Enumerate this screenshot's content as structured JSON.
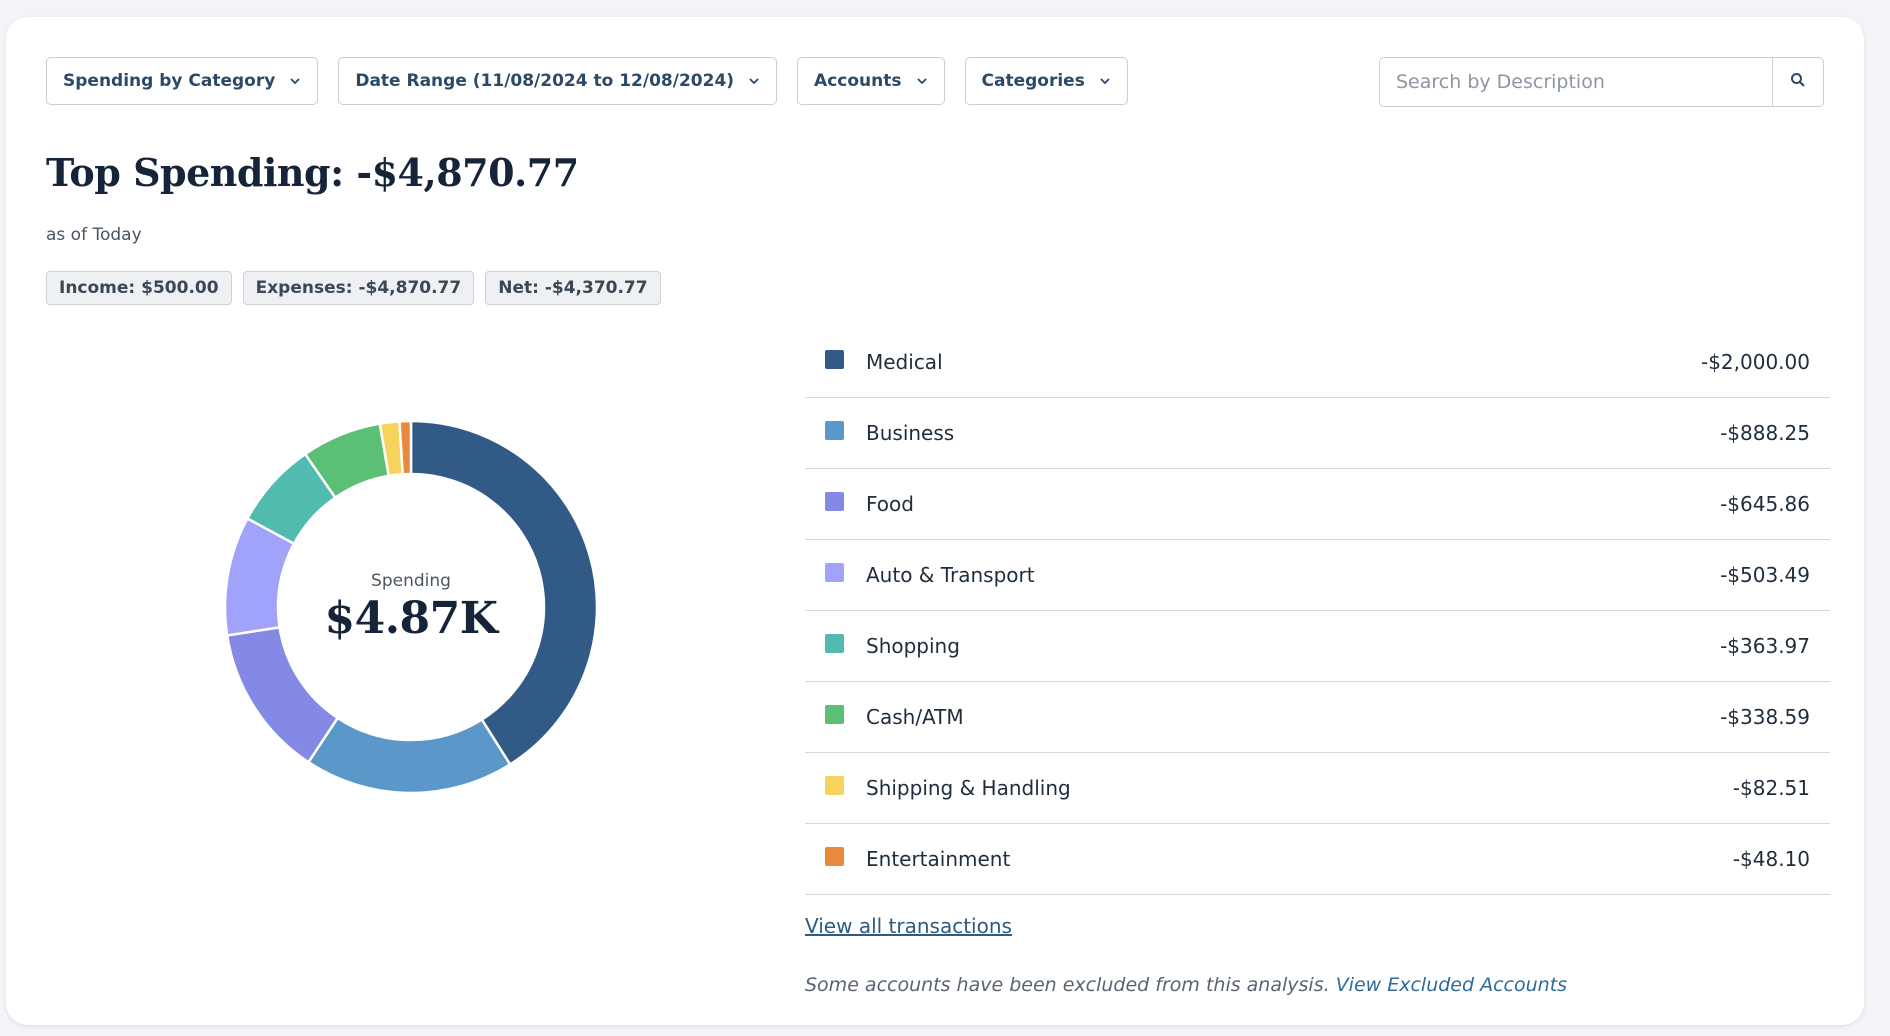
{
  "toolbar": {
    "report": {
      "label": "Spending by Category",
      "icon": "chevron-down-icon"
    },
    "date_range": {
      "label": "Date Range (11/08/2024 to 12/08/2024)",
      "icon": "chevron-down-icon"
    },
    "accounts": {
      "label": "Accounts",
      "icon": "chevron-down-icon"
    },
    "categories": {
      "label": "Categories",
      "icon": "chevron-down-icon"
    }
  },
  "search": {
    "placeholder": "Search by Description",
    "value": "",
    "icon": "search-icon"
  },
  "summary": {
    "title": "Top Spending: -$4,870.77",
    "subtitle": "as of Today",
    "income": "Income: $500.00",
    "expenses": "Expenses: -$4,870.77",
    "net": "Net: -$4,370.77"
  },
  "donut": {
    "label": "Spending",
    "value": "$4.87K"
  },
  "chart_data": {
    "type": "pie",
    "style": "donut",
    "total": 4870.77,
    "categories": [
      "Medical",
      "Business",
      "Food",
      "Auto & Transport",
      "Shopping",
      "Cash/ATM",
      "Shipping & Handling",
      "Entertainment"
    ],
    "values": [
      2000.0,
      888.25,
      645.86,
      503.49,
      363.97,
      338.59,
      82.51,
      48.1
    ],
    "display_values": [
      "-$2,000.00",
      "-$888.25",
      "-$645.86",
      "-$503.49",
      "-$363.97",
      "-$338.59",
      "-$82.51",
      "-$48.10"
    ],
    "colors": [
      "#315b86",
      "#5b98c9",
      "#8489e6",
      "#a1a3fa",
      "#50bbae",
      "#5bbf75",
      "#f6d35c",
      "#e9893b"
    ],
    "legend_placement": "right"
  },
  "links": {
    "view_all": "View all transactions",
    "excluded_note": "Some accounts have been excluded from this analysis.",
    "view_excluded": "View Excluded Accounts"
  }
}
